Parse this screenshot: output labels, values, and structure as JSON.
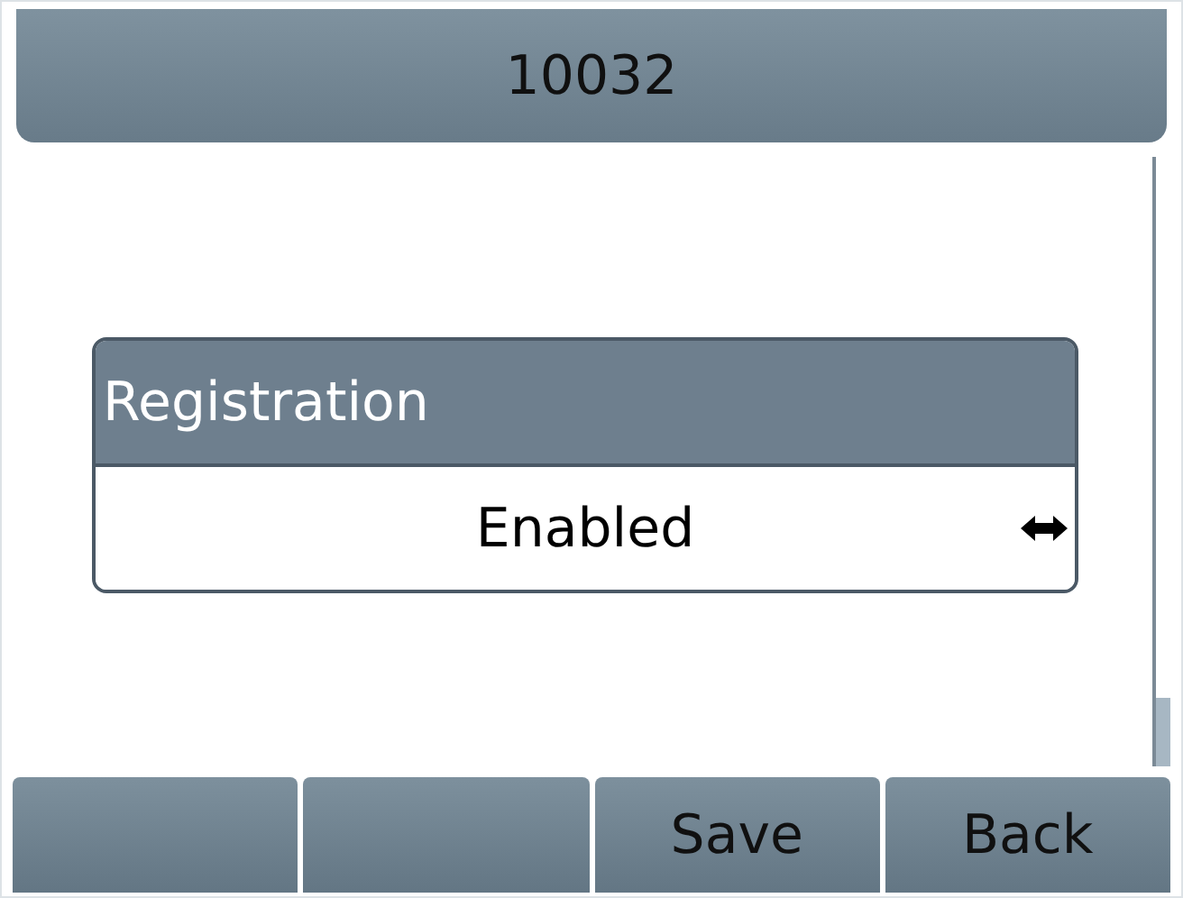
{
  "title": "10032",
  "setting": {
    "label": "Registration",
    "value": "Enabled"
  },
  "softkeys": [
    {
      "kind": "blank"
    },
    {
      "kind": "blank"
    },
    {
      "kind": "labeled",
      "label": "Save"
    },
    {
      "kind": "labeled",
      "label": "Back"
    }
  ]
}
